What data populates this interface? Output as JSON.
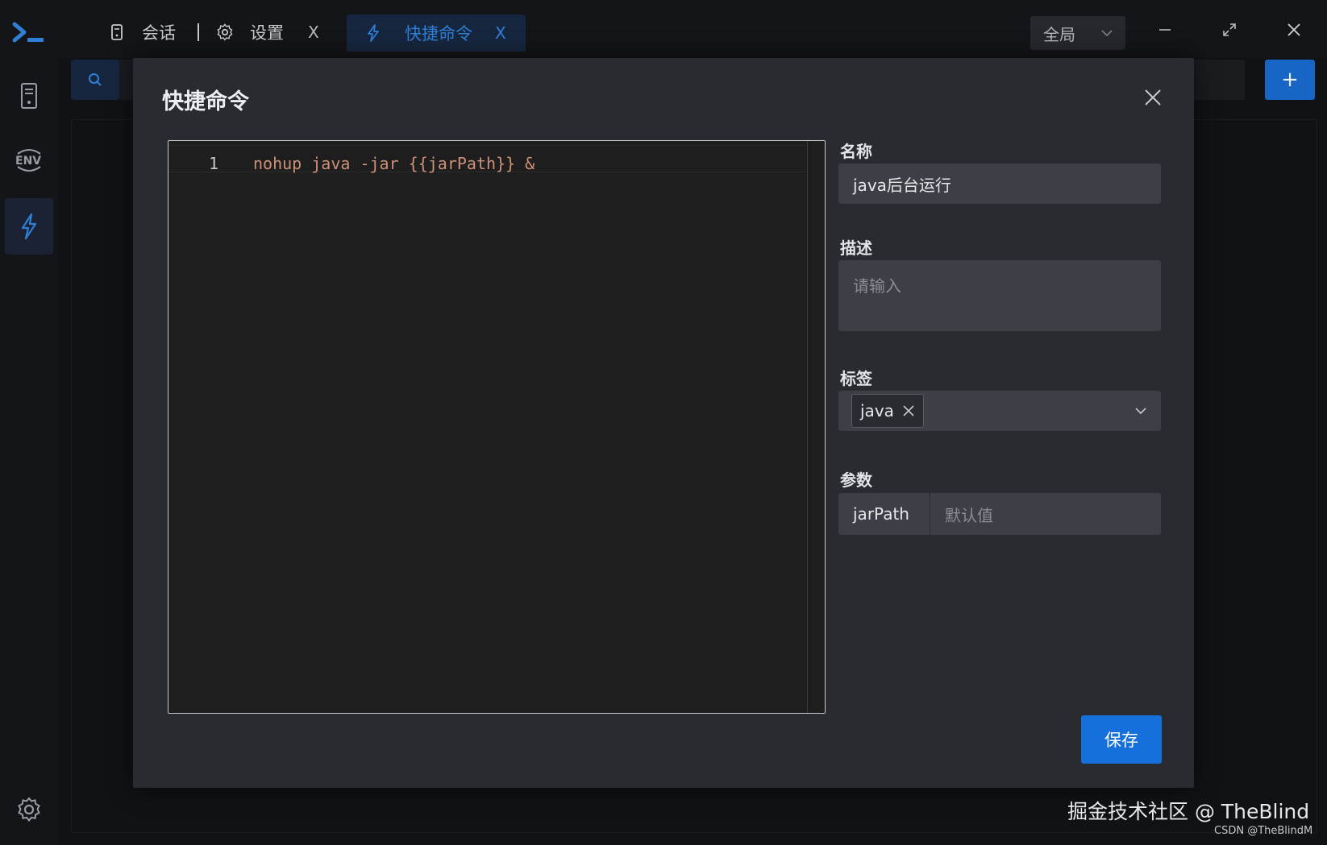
{
  "titlebar": {
    "tabs": [
      {
        "label": "会话",
        "icon": "server-icon"
      },
      {
        "label": "设置",
        "icon": "gear-icon",
        "close": "X"
      },
      {
        "label": "快捷命令",
        "icon": "lightning-icon",
        "close": "X",
        "active": true
      }
    ],
    "scope_select": {
      "value": "全局"
    }
  },
  "sidebar": {
    "items": [
      {
        "name": "hosts",
        "icon": "server-icon"
      },
      {
        "name": "env",
        "icon": "env-icon"
      },
      {
        "name": "quick-commands",
        "icon": "lightning-icon",
        "active": true
      },
      {
        "name": "settings",
        "icon": "gear-icon"
      }
    ]
  },
  "toolbar": {
    "add_label": "+"
  },
  "modal": {
    "title": "快捷命令",
    "editor": {
      "line_numbers": [
        "1"
      ],
      "code_lines": [
        "nohup java -jar {{jarPath}} &"
      ]
    },
    "form": {
      "name_label": "名称",
      "name_value": "java后台运行",
      "desc_label": "描述",
      "desc_placeholder": "请输入",
      "tags_label": "标签",
      "tags": [
        "java"
      ],
      "params_label": "参数",
      "params": [
        {
          "name": "jarPath",
          "default_placeholder": "默认值"
        }
      ]
    },
    "save_label": "保存"
  },
  "watermark": {
    "main": "掘金技术社区 @ TheBlind",
    "sub": "CSDN @TheBlindM"
  },
  "colors": {
    "accent": "#1670dc",
    "active_tab_text": "#2f7fd6",
    "code": "#ce9178",
    "modal_bg": "#2a2b31",
    "input_bg": "#3d3f46"
  }
}
